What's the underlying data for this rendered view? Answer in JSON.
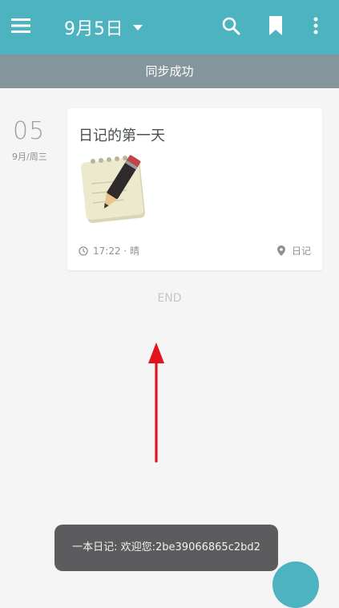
{
  "appbar": {
    "title": "9月5日",
    "icons": [
      "menu-icon",
      "chevron-down-icon",
      "search-icon",
      "bookmark-icon",
      "more-vert-icon"
    ],
    "color": "#4db3c1"
  },
  "sync_bar": {
    "message": "同步成功"
  },
  "entry": {
    "day": "05",
    "month_weekday": "9月/周三",
    "title": "日记的第一天",
    "image_icon": "note-pencil-icon",
    "time_weather": "17:22 · 晴",
    "category": "日记"
  },
  "list_end": "END",
  "toast": {
    "message": "一本日记: 欢迎您:2be39066865c2bd2"
  },
  "colors": {
    "accent": "#4db3c1",
    "arrow": "#e4141b",
    "toast_bg": "#5c5c5e"
  }
}
